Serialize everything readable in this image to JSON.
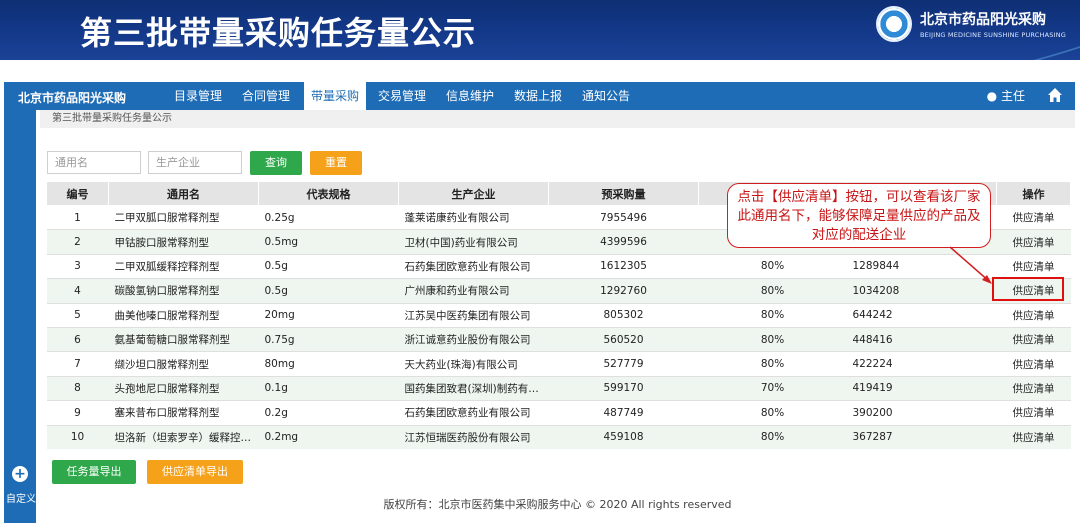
{
  "slide": {
    "title": "第三批带量采购任务量公示",
    "brand_cn": "北京市药品阳光采购",
    "brand_en": "BEIJING MEDICINE SUNSHINE PURCHASING"
  },
  "navbar": {
    "app_name": "北京市药品阳光采购",
    "items": [
      "目录管理",
      "合同管理",
      "带量采购",
      "交易管理",
      "信息维护",
      "数据上报",
      "通知公告"
    ],
    "active_index": 2,
    "user": "主任"
  },
  "sidebar": {
    "custom_label": "自定义"
  },
  "breadcrumb": "第三批带量采购任务量公示",
  "filters": {
    "generic_placeholder": "通用名",
    "maker_placeholder": "生产企业",
    "query_label": "查询",
    "reset_label": "重置"
  },
  "table": {
    "headers": [
      "编号",
      "通用名",
      "代表规格",
      "生产企业",
      "预采购量",
      "",
      "",
      "操作"
    ],
    "rows": [
      {
        "no": "1",
        "name": "二甲双胍口服常释剂型",
        "spec": "0.25g",
        "maker": "蓬莱诺康药业有限公司",
        "qty": "7955496",
        "pct": "",
        "task": "",
        "op": "供应清单"
      },
      {
        "no": "2",
        "name": "甲钴胺口服常释剂型",
        "spec": "0.5mg",
        "maker": "卫材(中国)药业有限公司",
        "qty": "4399596",
        "pct": "",
        "task": "",
        "op": "供应清单"
      },
      {
        "no": "3",
        "name": "二甲双胍缓释控释剂型",
        "spec": "0.5g",
        "maker": "石药集团欧意药业有限公司",
        "qty": "1612305",
        "pct": "80%",
        "task": "1289844",
        "op": "供应清单"
      },
      {
        "no": "4",
        "name": "碳酸氢钠口服常释剂型",
        "spec": "0.5g",
        "maker": "广州康和药业有限公司",
        "qty": "1292760",
        "pct": "80%",
        "task": "1034208",
        "op": "供应清单"
      },
      {
        "no": "5",
        "name": "曲美他嗪口服常释剂型",
        "spec": "20mg",
        "maker": "江苏吴中医药集团有限公司",
        "qty": "805302",
        "pct": "80%",
        "task": "644242",
        "op": "供应清单"
      },
      {
        "no": "6",
        "name": "氨基葡萄糖口服常释剂型",
        "spec": "0.75g",
        "maker": "浙江诚意药业股份有限公司",
        "qty": "560520",
        "pct": "80%",
        "task": "448416",
        "op": "供应清单"
      },
      {
        "no": "7",
        "name": "缬沙坦口服常释剂型",
        "spec": "80mg",
        "maker": "天大药业(珠海)有限公司",
        "qty": "527779",
        "pct": "80%",
        "task": "422224",
        "op": "供应清单"
      },
      {
        "no": "8",
        "name": "头孢地尼口服常释剂型",
        "spec": "0.1g",
        "maker": "国药集团致君(深圳)制药有限公司",
        "qty": "599170",
        "pct": "70%",
        "task": "419419",
        "op": "供应清单"
      },
      {
        "no": "9",
        "name": "塞来昔布口服常释剂型",
        "spec": "0.2g",
        "maker": "石药集团欧意药业有限公司",
        "qty": "487749",
        "pct": "80%",
        "task": "390200",
        "op": "供应清单"
      },
      {
        "no": "10",
        "name": "坦洛新（坦索罗辛）缓释控释剂型",
        "spec": "0.2mg",
        "maker": "江苏恒瑞医药股份有限公司",
        "qty": "459108",
        "pct": "80%",
        "task": "367287",
        "op": "供应清单"
      }
    ]
  },
  "actions": {
    "export_task": "任务量导出",
    "export_supply": "供应清单导出"
  },
  "footer": "版权所有：北京市医药集中采购服务中心 © 2020 All rights reserved",
  "callout": "点击【供应清单】按钮，可以查看该厂家此通用名下，能够保障足量供应的产品及对应的配送企业",
  "colors": {
    "nav_blue": "#1e6cb5",
    "banner_blue": "#14398a",
    "green": "#2fa84c",
    "orange": "#f5a11a",
    "callout_red": "#d21e1e"
  }
}
